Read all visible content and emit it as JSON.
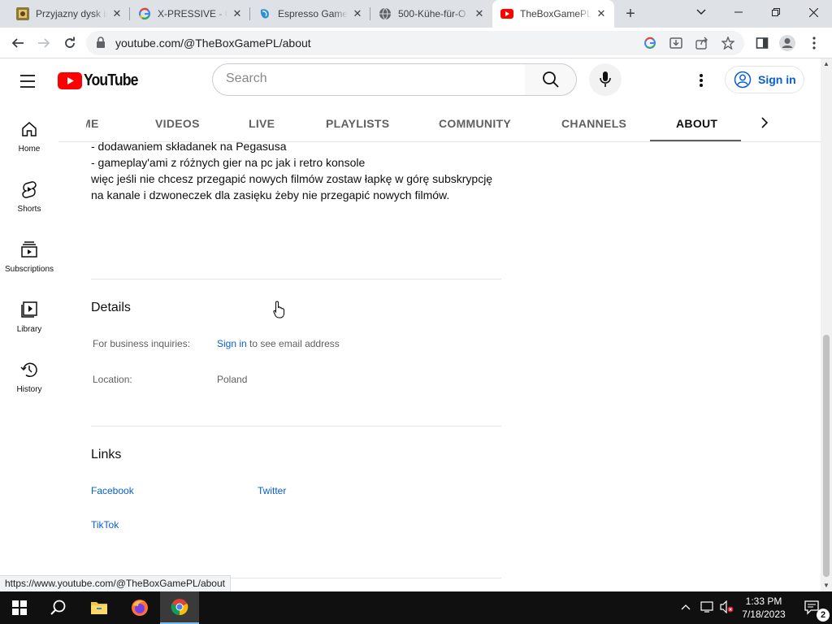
{
  "browser": {
    "tabs": [
      {
        "title": "Przyjazny dysk ir",
        "favicon": "app-icon"
      },
      {
        "title": "X-PRESSIVE - Go",
        "favicon": "google-g-icon"
      },
      {
        "title": "Espresso Games",
        "favicon": "espresso-icon"
      },
      {
        "title": "500-Kühe-für-O",
        "favicon": "globe-icon"
      },
      {
        "title": "TheBoxGamePL",
        "favicon": "youtube-icon"
      }
    ],
    "new_tab_glyph": "+",
    "url": "youtube.com/@TheBoxGamePL/about"
  },
  "youtube": {
    "logo_text": "YouTube",
    "search_placeholder": "Search",
    "sign_in_label": "Sign in",
    "guide": [
      {
        "label": "Home",
        "icon": "home-icon"
      },
      {
        "label": "Shorts",
        "icon": "shorts-icon"
      },
      {
        "label": "Subscriptions",
        "icon": "subscriptions-icon"
      },
      {
        "label": "Library",
        "icon": "library-icon"
      },
      {
        "label": "History",
        "icon": "history-icon"
      }
    ],
    "channel_tabs": [
      "ME",
      "VIDEOS",
      "LIVE",
      "PLAYLISTS",
      "COMMUNITY",
      "CHANNELS",
      "ABOUT"
    ],
    "active_tab": "ABOUT"
  },
  "about": {
    "description_lines": [
      "- dodawaniem składanek na Pegasusa",
      "-  gameplay'ami z różnych gier na pc jak i retro konsole",
      "więc jeśli nie chcesz przegapić nowych filmów zostaw łapkę w górę subskrypcję",
      "na kanale i dzwoneczek dla zasięku żeby nie przegapić nowych filmów."
    ],
    "details_title": "Details",
    "business_label": "For business inquiries:",
    "business_link": "Sign in",
    "business_suffix": " to see email address",
    "location_label": "Location:",
    "location_value": "Poland",
    "links_title": "Links",
    "links": [
      "Facebook",
      "Twitter",
      "TikTok"
    ]
  },
  "status_url": "https://www.youtube.com/@TheBoxGamePL/about",
  "taskbar": {
    "time": "1:33 PM",
    "date": "7/18/2023",
    "notification_count": "2"
  },
  "colors": {
    "youtube_red": "#ff0000",
    "link_blue": "#065fd4",
    "chrome_tabstrip": "#dee1e6"
  }
}
